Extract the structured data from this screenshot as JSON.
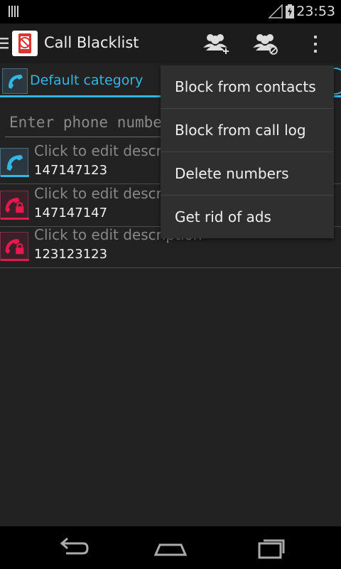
{
  "status_bar": {
    "time": "23:53"
  },
  "action_bar": {
    "title": "Call Blacklist",
    "icons": [
      "menu-lines-icon",
      "app-icon",
      "add-contact-icon",
      "block-contact-icon",
      "overflow-menu-icon"
    ]
  },
  "category": {
    "label": "Default category"
  },
  "phone_input": {
    "placeholder": "Enter phone number"
  },
  "entries": [
    {
      "description": "Click to edit description",
      "number": "147147123",
      "type": "phone"
    },
    {
      "description": "Click to edit description",
      "number": "147147147",
      "type": "blocked"
    },
    {
      "description": "Click to edit description",
      "number": "123123123",
      "type": "blocked"
    }
  ],
  "menu": {
    "items": [
      "Block from contacts",
      "Block from call log",
      "Delete numbers",
      "Get rid of ads"
    ]
  },
  "colors": {
    "accent": "#33b5e5",
    "blocked": "#e5194d",
    "background": "#222222"
  }
}
